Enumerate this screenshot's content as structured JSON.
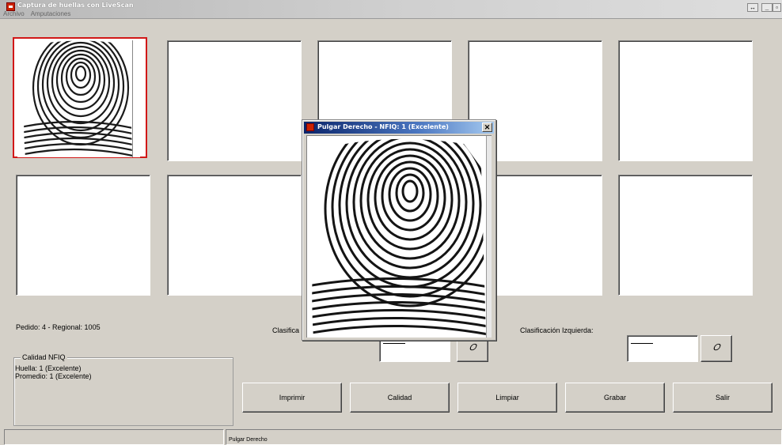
{
  "window": {
    "title": "Captura de huellas con LiveScan",
    "restore_glyph": "↔",
    "minimize_glyph": "_",
    "maximize_glyph": "▫"
  },
  "menu": {
    "items": [
      "Archivo",
      "Amputaciones"
    ]
  },
  "info": {
    "pedido": "Pedido: 4 - Regional: 1005",
    "clasificacion_derecha_label": "Clasifica",
    "clasificacion_izquierda_label": "Clasificación Izquierda:",
    "eraser_glyph": "𝑂"
  },
  "nfiq": {
    "legend": "Calidad NFIQ",
    "huella": "Huella: 1 (Excelente)",
    "promedio": "Promedio: 1 (Excelente)"
  },
  "buttons": {
    "imprimir": "Imprimir",
    "calidad": "Calidad",
    "limpiar": "Limpiar",
    "grabar": "Grabar",
    "salir": "Salir"
  },
  "status": {
    "left": "",
    "right": "Pulgar Derecho"
  },
  "popup": {
    "title": "Pulgar Derecho - NFIQ: 1 (Excelente)",
    "close_glyph": "✕"
  }
}
